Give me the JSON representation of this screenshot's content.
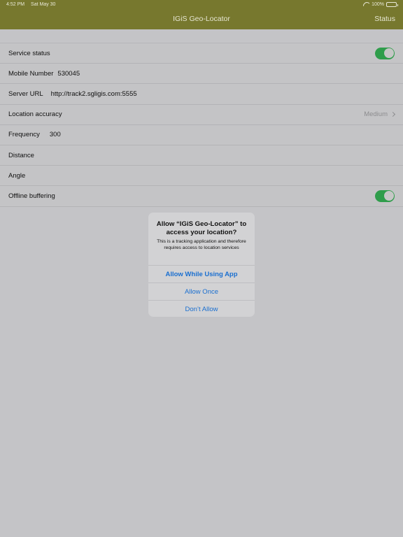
{
  "status_bar": {
    "time": "4:52 PM",
    "date": "Sat May 30",
    "battery": "100%"
  },
  "navbar": {
    "title": "IGiS Geo-Locator",
    "status_button": "Status"
  },
  "settings": {
    "service_status": {
      "label": "Service status",
      "enabled": true
    },
    "mobile_number": {
      "label": "Mobile Number",
      "value": "530045"
    },
    "server_url": {
      "label": "Server URL",
      "value": "http://track2.sgligis.com:5555"
    },
    "location_accuracy": {
      "label": "Location accuracy",
      "value": "Medium"
    },
    "frequency": {
      "label": "Frequency",
      "value": "300"
    },
    "distance": {
      "label": "Distance",
      "value": ""
    },
    "angle": {
      "label": "Angle",
      "value": ""
    },
    "offline_buffering": {
      "label": "Offline buffering",
      "enabled": true
    }
  },
  "alert": {
    "title": "Allow “IGiS Geo-Locator” to access your location?",
    "message": "This is a tracking application and therefore requires access to location services",
    "buttons": [
      "Allow While Using App",
      "Allow Once",
      "Don’t Allow"
    ]
  },
  "colors": {
    "navbar": "#77782e",
    "toggle_on": "#2f9d4b",
    "alert_button": "#1a6fd0"
  }
}
